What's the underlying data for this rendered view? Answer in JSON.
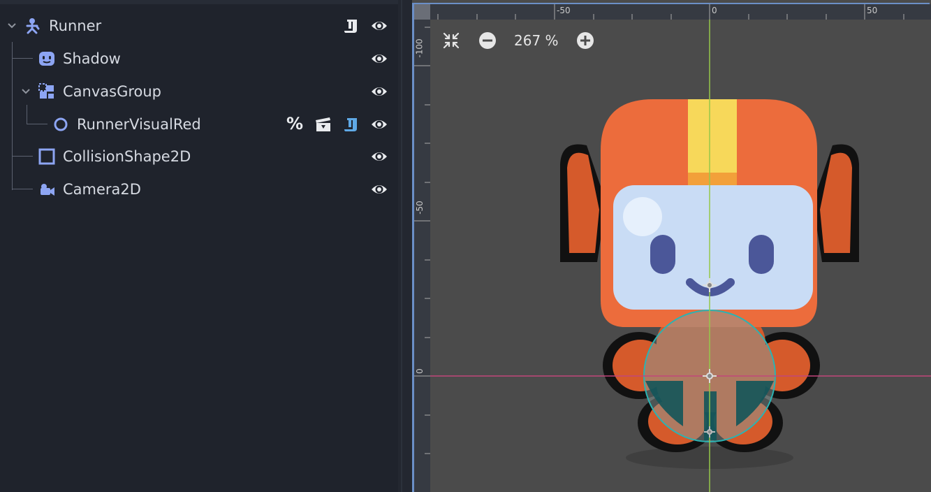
{
  "scene_tree": {
    "nodes": [
      {
        "name": "Runner",
        "icon": "character-body-icon",
        "collapsible": true,
        "badges": [
          "script-icon"
        ],
        "visible": true
      },
      {
        "name": "Shadow",
        "icon": "sprite-icon",
        "collapsible": false,
        "badges": [],
        "visible": true
      },
      {
        "name": "CanvasGroup",
        "icon": "canvas-group-icon",
        "collapsible": true,
        "badges": [],
        "visible": true
      },
      {
        "name": "RunnerVisualRed",
        "icon": "node2d-icon",
        "collapsible": false,
        "badges": [
          "unique-name-icon",
          "scene-instance-icon",
          "script-icon"
        ],
        "visible": true
      },
      {
        "name": "CollisionShape2D",
        "icon": "collision-shape-icon",
        "collapsible": false,
        "badges": [],
        "visible": true
      },
      {
        "name": "Camera2D",
        "icon": "camera-icon",
        "collapsible": false,
        "badges": [],
        "visible": true
      }
    ],
    "unique_name_symbol": "%"
  },
  "viewport": {
    "zoom_label": "267 %",
    "ruler_top_labels": [
      "-50",
      "0",
      "50"
    ],
    "ruler_left_labels": [
      "-100",
      "-50",
      "0"
    ]
  },
  "colors": {
    "node_icon": "#8da5f3",
    "x_axis": "#c2467a",
    "y_axis": "#96c84a",
    "collision_shape": "#2bb3b3",
    "helmet": "#ec6c3c",
    "stripe": "#f7d85a",
    "visor": "#c9dcf5"
  }
}
